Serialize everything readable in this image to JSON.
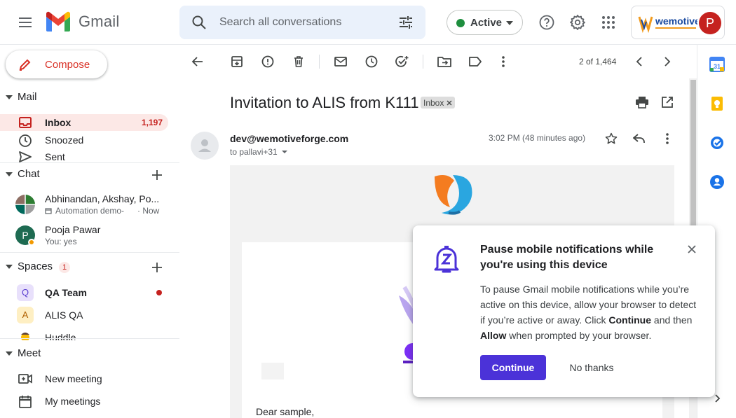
{
  "app": {
    "name": "Gmail"
  },
  "search": {
    "placeholder": "Search all conversations"
  },
  "status": {
    "label": "Active",
    "color": "#1e8e3e"
  },
  "account": {
    "org_logo": "wemotive",
    "initial": "P"
  },
  "compose": {
    "label": "Compose"
  },
  "mail_section": {
    "title": "Mail",
    "items": [
      {
        "label": "Inbox",
        "count": "1,197",
        "icon": "inbox-icon",
        "selected": true
      },
      {
        "label": "Snoozed",
        "icon": "clock-icon"
      },
      {
        "label": "Sent",
        "icon": "send-icon"
      }
    ]
  },
  "chat_section": {
    "title": "Chat",
    "items": [
      {
        "name": "Abhinandan, Akshay, Po...",
        "sub": "Automation demo-",
        "time": "Now"
      },
      {
        "name": "Pooja Pawar",
        "sub": "You: yes",
        "initial": "P"
      }
    ]
  },
  "spaces_section": {
    "title": "Spaces",
    "badge": "1",
    "items": [
      {
        "letter": "Q",
        "label": "QA Team",
        "unread": true
      },
      {
        "letter": "A",
        "label": "ALIS QA"
      },
      {
        "letter": "",
        "label": "Huddle"
      }
    ]
  },
  "meet_section": {
    "title": "Meet",
    "items": [
      {
        "label": "New meeting",
        "icon": "video-plus-icon"
      },
      {
        "label": "My meetings",
        "icon": "calendar-icon"
      }
    ]
  },
  "toolbar": {
    "pager": "2 of 1,464"
  },
  "email": {
    "subject": "Invitation to ALIS from K111",
    "label_chip": "Inbox",
    "sender": "dev@wemotiveforge.com",
    "to": "to pallavi+31",
    "time": "3:02 PM (48 minutes ago)",
    "greeting": "Dear sample,"
  },
  "popup": {
    "title": "Pause mobile notifications while you're using this device",
    "body_1": "To pause Gmail mobile notifications while you’re active on this device, allow your browser to detect if you’re active or away. Click ",
    "body_bold_1": "Continue",
    "body_2": " and then ",
    "body_bold_2": "Allow",
    "body_3": " when prompted by your browser.",
    "continue_label": "Continue",
    "nothanks_label": "No thanks"
  },
  "colors": {
    "accent": "#c5221f",
    "selected_bg": "#fce8e6",
    "popup_button": "#4b32d8"
  }
}
